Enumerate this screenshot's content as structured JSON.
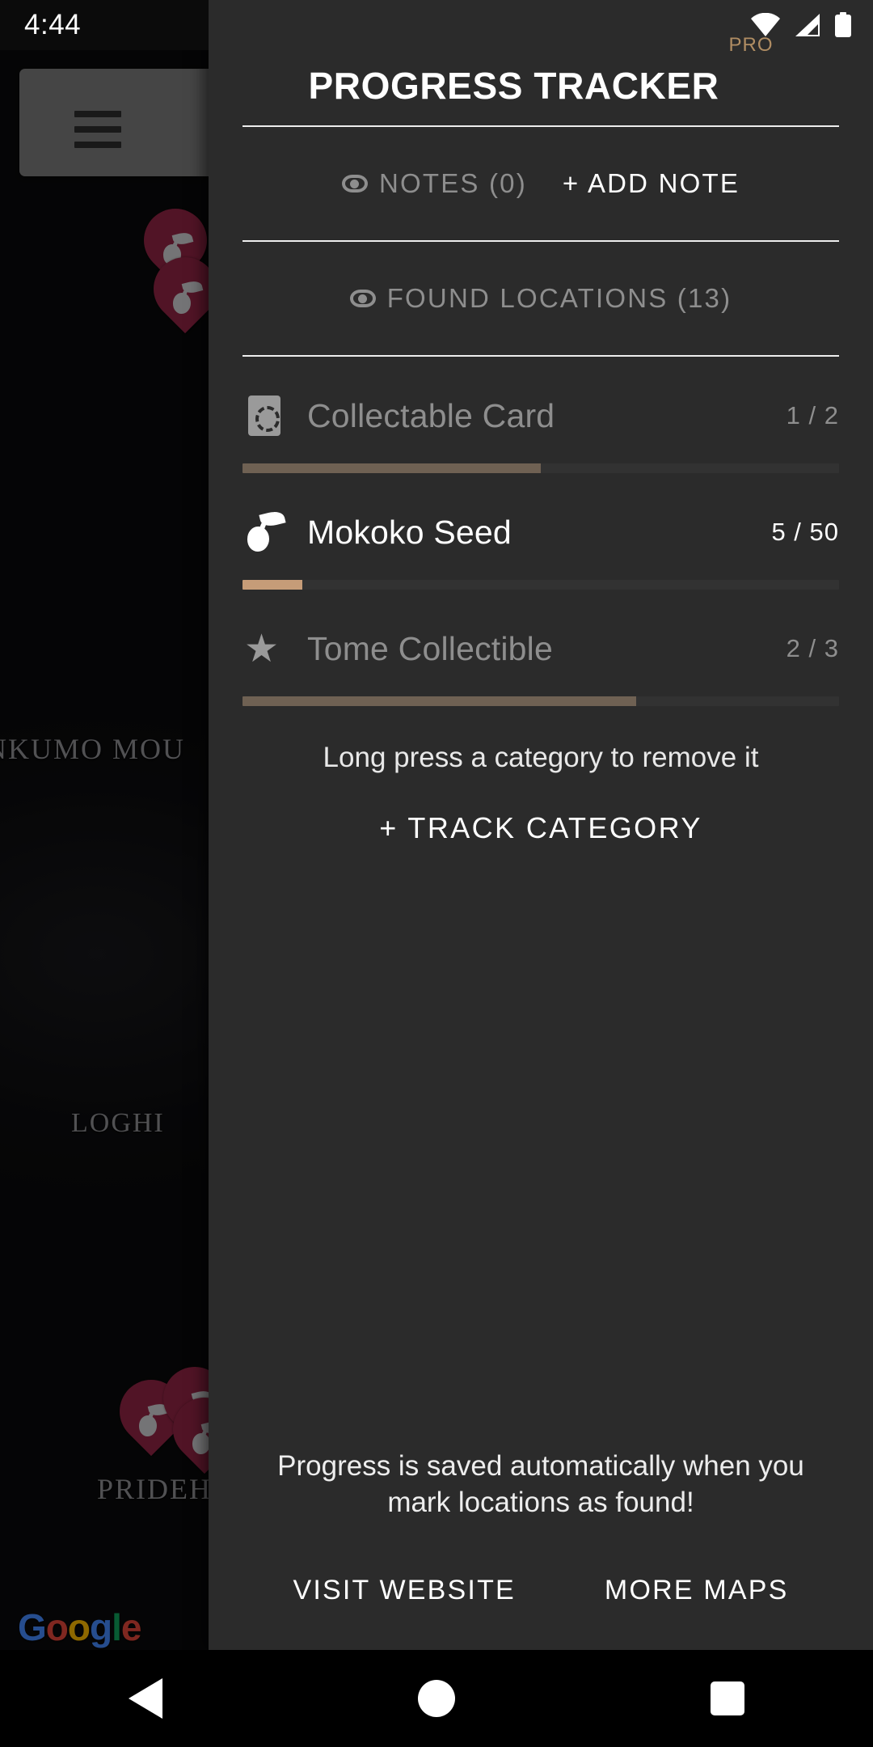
{
  "status_bar": {
    "time": "4:44",
    "icons": [
      "wifi-icon",
      "cellular-signal-icon",
      "battery-icon"
    ]
  },
  "map": {
    "menu_button_icon": "hamburger-menu-icon",
    "labels": [
      {
        "text": "NKUMO MOU"
      },
      {
        "text": "LOGHI"
      },
      {
        "text": "PRIDEH"
      }
    ],
    "pin_icon": "mokoko-seed-pin-icon",
    "attribution": {
      "g1": "G",
      "o1": "o",
      "o2": "o",
      "g2": "g",
      "l": "l",
      "e": "e"
    }
  },
  "panel": {
    "title": "PROGRESS TRACKER",
    "pro_badge": "PRO",
    "notes": {
      "eye_icon": "eye-icon",
      "label": "NOTES (0)",
      "add_label": "+ ADD NOTE"
    },
    "found_locations": {
      "eye_icon": "eye-icon",
      "label": "FOUND LOCATIONS (13)"
    },
    "categories": [
      {
        "icon": "collectable-card-icon",
        "name": "Collectable Card",
        "count": "1 / 2",
        "found": 1,
        "total": 2,
        "percent": 50,
        "state": "dim"
      },
      {
        "icon": "mokoko-seed-icon",
        "name": "Mokoko Seed",
        "count": "5 / 50",
        "found": 5,
        "total": 50,
        "percent": 10,
        "state": "active"
      },
      {
        "icon": "star-icon",
        "name": "Tome Collectible",
        "count": "2 / 3",
        "found": 2,
        "total": 3,
        "percent": 66,
        "state": "dim"
      }
    ],
    "hint": "Long press a category to remove it",
    "track_category": "+ TRACK CATEGORY",
    "footer_note": "Progress is saved automatically when you mark locations as found!",
    "links": [
      {
        "label": "VISIT WEBSITE"
      },
      {
        "label": "MORE MAPS"
      }
    ]
  },
  "nav_bar": {
    "back": "back-button",
    "home": "home-button",
    "recents": "recents-button"
  },
  "colors": {
    "panel_bg": "#2b2b2b",
    "accent_active": "#c69c78",
    "accent_dim": "#6f6153",
    "pro_gold": "#b08d63",
    "muted_text": "#8e8e8e",
    "pin": "#8c2342"
  }
}
